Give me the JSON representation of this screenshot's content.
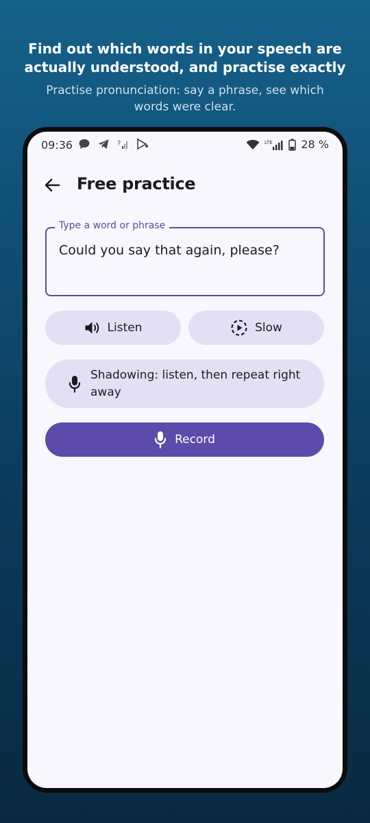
{
  "promo": {
    "headline": "Find out which words in your speech are actually understood, and practise exactly",
    "subtitle": "Practise pronunciation: say a phrase, see which words were clear."
  },
  "status_bar": {
    "time": "09:36",
    "battery_percent": "28 %",
    "network_label": "LTE",
    "left_icons": [
      "chat-bubble-icon",
      "telegram-icon",
      "signal-question-icon",
      "play-store-icon"
    ],
    "right_icons": [
      "wifi-icon",
      "cell-signal-icon",
      "battery-icon"
    ]
  },
  "app_bar": {
    "title": "Free practice",
    "back_icon": "arrow-back-icon"
  },
  "input": {
    "label": "Type a word or phrase",
    "value": "Could you say that again, please?"
  },
  "buttons": {
    "listen_label": "Listen",
    "slow_label": "Slow",
    "shadowing_label": "Shadowing: listen, then repeat right away",
    "record_label": "Record"
  },
  "colors": {
    "accent": "#5d4bab",
    "tonal_button": "#e3e0f5",
    "screen_bg": "#f8f7fd",
    "outline": "#5b4aa3"
  }
}
